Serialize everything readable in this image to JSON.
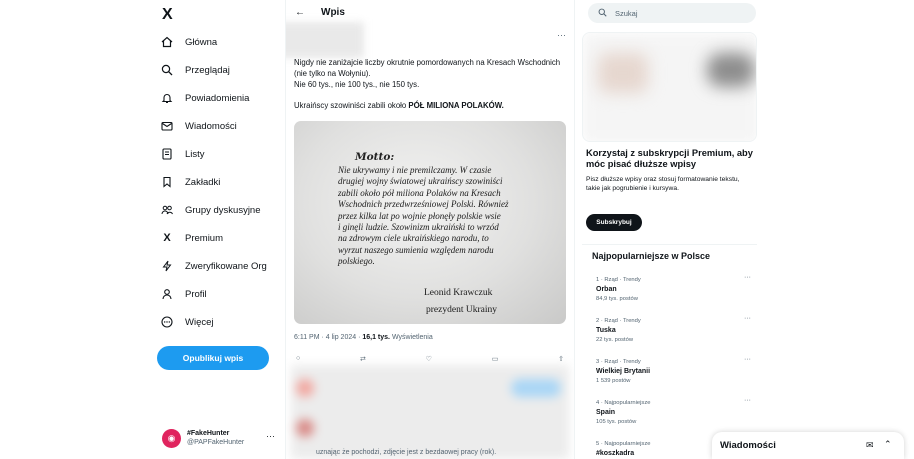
{
  "nav": {
    "logo": "X",
    "items": [
      {
        "label": "Główna",
        "icon": "home-icon"
      },
      {
        "label": "Przeglądaj",
        "icon": "search-icon"
      },
      {
        "label": "Powiadomienia",
        "icon": "bell-icon"
      },
      {
        "label": "Wiadomości",
        "icon": "mail-icon"
      },
      {
        "label": "Listy",
        "icon": "list-icon"
      },
      {
        "label": "Zakładki",
        "icon": "bookmark-icon"
      },
      {
        "label": "Grupy dyskusyjne",
        "icon": "people-icon"
      },
      {
        "label": "Premium",
        "icon": "x-icon"
      },
      {
        "label": "Zweryfikowane Org",
        "icon": "lightning-icon"
      },
      {
        "label": "Profil",
        "icon": "person-icon"
      },
      {
        "label": "Więcej",
        "icon": "more-circle-icon"
      }
    ],
    "post_button": "Opublikuj wpis",
    "account": {
      "name": "#FakeHunter",
      "handle": "@PAPFakeHunter"
    }
  },
  "center": {
    "title": "Wpis",
    "tweet": {
      "line1": "Nigdy nie zaniżajcie liczby okrutnie pomordowanych na Kresach Wschodnich (nie tylko na Wołyniu).",
      "line2": "Nie 60 tys., nie 100 tys., nie 150 tys.",
      "line3_prefix": "Ukraińscy szowiniści zabili około ",
      "line3_bold": "PÓŁ MILIONA POLAKÓW."
    },
    "photo": {
      "motto": "Motto:",
      "lines": [
        "Nie ukrywamy i nie premilczamy. W czasie",
        "drugiej wojny światowej ukraińscy szowiniści",
        "zabili około pół miliona Polaków na Kresach",
        "Wschodnich przedwrześniowej Polski. Również",
        "przez kilka lat po wojnie płonęły polskie wsie",
        "i ginęli ludzie. Szowinizm ukraiński to wrzód",
        "na zdrowym ciele ukraińskiego narodu, to",
        "wyrzut naszego sumienia względem narodu",
        "polskiego."
      ],
      "signature_name": "Leonid Krawczuk",
      "signature_title": "prezydent Ukrainy"
    },
    "meta": {
      "time": "6:11 PM · 4 lip 2024 · ",
      "views": "16,1 tys.",
      "views_label": " Wyświetlenia"
    },
    "bottom_text": "uznając że pochodzi, zdjęcie jest z bezdaowej pracy (rok)."
  },
  "right": {
    "search_placeholder": "Szukaj",
    "premium": {
      "heading": "Korzystaj z subskrypcji Premium, aby móc pisać dłuższe wpisy",
      "text": "Pisz dłuższe wpisy oraz stosuj formatowanie tekstu, takie jak pogrubienie i kursywa.",
      "button": "Subskrybuj"
    },
    "trends_heading": "Najpopularniejsze w Polsce",
    "trends": [
      {
        "context": "1 · Rząd · Trendy",
        "name": "Orban",
        "count": "84,9 tys. postów"
      },
      {
        "context": "2 · Rząd · Trendy",
        "name": "Tuska",
        "count": "22 tys. postów"
      },
      {
        "context": "3 · Rząd · Trendy",
        "name": "Wielkiej Brytanii",
        "count": "1 539 postów"
      },
      {
        "context": "4 · Najpopularniejsze",
        "name": "Spain",
        "count": "105 tys. postów"
      },
      {
        "context": "5 · Najpopularniejsze",
        "name": "#koszkadra",
        "count": ""
      }
    ],
    "messages_label": "Wiadomości"
  }
}
